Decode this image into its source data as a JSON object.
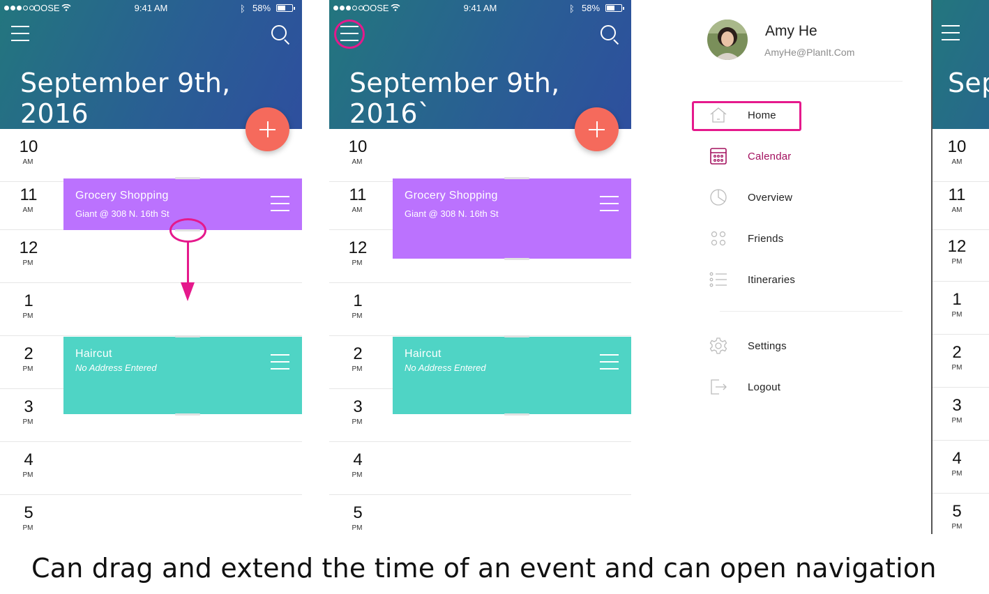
{
  "status": {
    "carrier": "OOSE",
    "time": "9:41 AM",
    "battery": "58%"
  },
  "phone1": {
    "date": "September 9th, 2016"
  },
  "phone2": {
    "date": "September 9th, 2016`"
  },
  "phone3": {
    "date": "Sep"
  },
  "hours": [
    {
      "num": "10",
      "ap": "AM"
    },
    {
      "num": "11",
      "ap": "AM"
    },
    {
      "num": "12",
      "ap": "PM"
    },
    {
      "num": "1",
      "ap": "PM"
    },
    {
      "num": "2",
      "ap": "PM"
    },
    {
      "num": "3",
      "ap": "PM"
    },
    {
      "num": "4",
      "ap": "PM"
    },
    {
      "num": "5",
      "ap": "PM"
    }
  ],
  "events": {
    "grocery": {
      "title": "Grocery Shopping",
      "subtitle": "Giant @ 308 N. 16th St",
      "color": "#bb72fe"
    },
    "haircut": {
      "title": "Haircut",
      "subtitle": "No Address Entered",
      "color": "#4fd4c5"
    }
  },
  "drawer": {
    "name": "Amy He",
    "email": "AmyHe@PlanIt.Com",
    "items": [
      {
        "label": "Home",
        "icon": "home-icon"
      },
      {
        "label": "Calendar",
        "icon": "calendar-icon"
      },
      {
        "label": "Overview",
        "icon": "pie-chart-icon"
      },
      {
        "label": "Friends",
        "icon": "friends-dots-icon"
      },
      {
        "label": "Itineraries",
        "icon": "list-icon"
      },
      {
        "label": "Settings",
        "icon": "gear-icon"
      },
      {
        "label": "Logout",
        "icon": "logout-icon"
      }
    ]
  },
  "colors": {
    "accent": "#e5198c",
    "fab": "#f56a5c",
    "active_nav": "#a3115f",
    "header_start": "#23767e",
    "header_end": "#2e4f9e"
  },
  "caption": "Can drag and extend the time of an event and can open navigation"
}
